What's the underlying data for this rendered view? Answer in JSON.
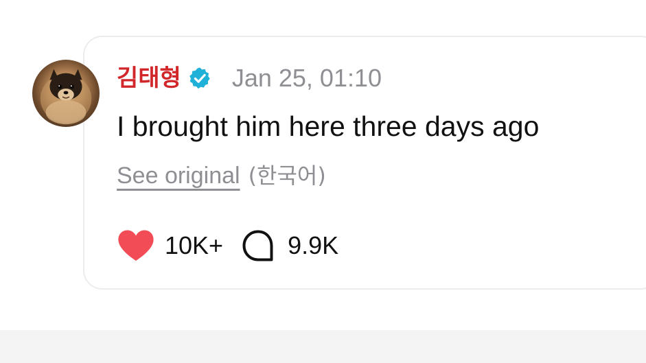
{
  "post": {
    "username": "김태형",
    "verified": true,
    "timestamp": "Jan 25, 01:10",
    "text": "I brought him here three days ago",
    "see_original_label": "See original",
    "original_language": "(한국어)",
    "likes": "10K+",
    "comments": "9.9K"
  },
  "colors": {
    "username": "#d1262a",
    "verified_badge": "#1fb1d8",
    "heart": "#f24d57",
    "muted_text": "#8e8e93",
    "card_border": "#ececee",
    "bottom_strip": "#f4f4f5"
  },
  "icons": {
    "avatar": "pomeranian-dog-photo",
    "verified": "verified-badge-icon",
    "like": "heart-icon",
    "comment": "comment-bubble-icon"
  }
}
